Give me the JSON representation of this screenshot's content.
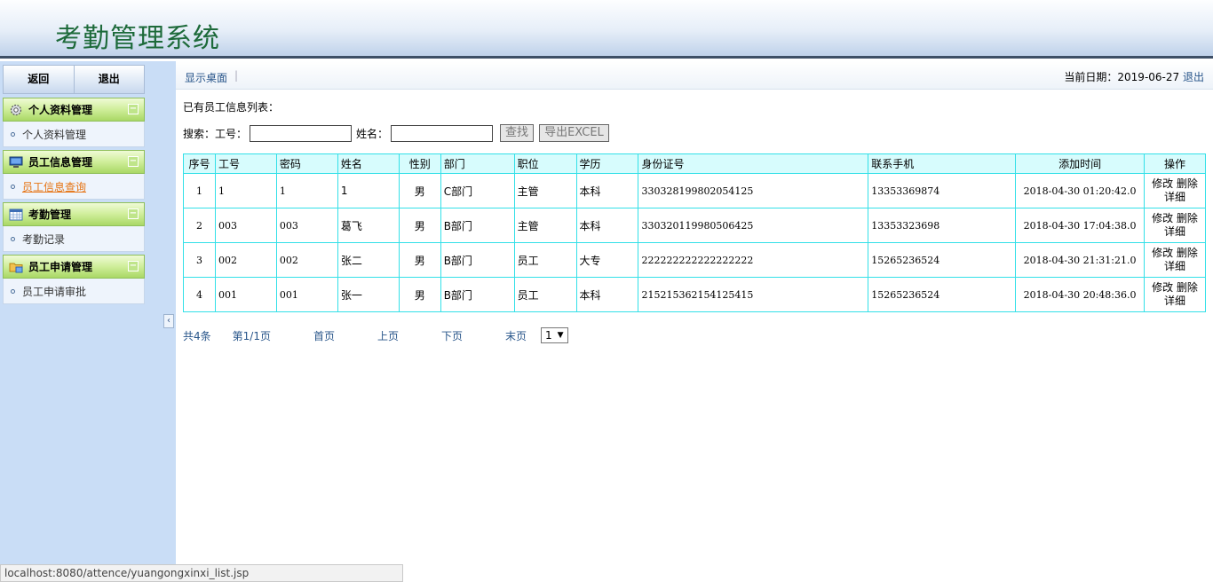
{
  "app": {
    "title": "考勤管理系统"
  },
  "sidebar": {
    "buttons": {
      "back": "返回",
      "exit": "退出"
    },
    "panels": [
      {
        "title": "个人资料管理",
        "icon": "gear-icon",
        "items": [
          "个人资料管理"
        ]
      },
      {
        "title": "员工信息管理",
        "icon": "monitor-icon",
        "items": [
          "员工信息查询"
        ]
      },
      {
        "title": "考勤管理",
        "icon": "calendar-icon",
        "items": [
          "考勤记录"
        ]
      },
      {
        "title": "员工申请管理",
        "icon": "folder-icon",
        "items": [
          "员工申请审批"
        ]
      }
    ],
    "active_item": "员工信息查询",
    "collapse_glyph": "‹"
  },
  "topbar": {
    "show_desktop": "显示桌面",
    "separator": "|",
    "date_label": "当前日期：",
    "date_value": "2019-06-27",
    "logout": "退出"
  },
  "main": {
    "list_title": "已有员工信息列表：",
    "search": {
      "prefix": "搜索：",
      "id_label": "工号：",
      "id_value": "",
      "name_label": "姓名：",
      "name_value": "",
      "find_button": "查找",
      "export_button": "导出EXCEL"
    }
  },
  "table": {
    "headers": [
      "序号",
      "工号",
      "密码",
      "姓名",
      "性别",
      "部门",
      "职位",
      "学历",
      "身份证号",
      "联系手机",
      "添加时间",
      "操作"
    ],
    "rows": [
      {
        "seq": "1",
        "id": "1",
        "pwd": "1",
        "name": "1",
        "gender": "男",
        "dept": "C部门",
        "position": "主管",
        "edu": "本科",
        "idcard": "330328199802054125",
        "phone": "13353369874",
        "added": "2018-04-30 01:20:42.0",
        "op_edit": "修改",
        "op_delete": "删除",
        "op_detail": "详细"
      },
      {
        "seq": "2",
        "id": "003",
        "pwd": "003",
        "name": "葛飞",
        "gender": "男",
        "dept": "B部门",
        "position": "主管",
        "edu": "本科",
        "idcard": "330320119980506425",
        "phone": "13353323698",
        "added": "2018-04-30 17:04:38.0",
        "op_edit": "修改",
        "op_delete": "删除",
        "op_detail": "详细"
      },
      {
        "seq": "3",
        "id": "002",
        "pwd": "002",
        "name": "张二",
        "gender": "男",
        "dept": "B部门",
        "position": "员工",
        "edu": "大专",
        "idcard": "222222222222222222",
        "phone": "15265236524",
        "added": "2018-04-30 21:31:21.0",
        "op_edit": "修改",
        "op_delete": "删除",
        "op_detail": "详细"
      },
      {
        "seq": "4",
        "id": "001",
        "pwd": "001",
        "name": "张一",
        "gender": "男",
        "dept": "B部门",
        "position": "员工",
        "edu": "本科",
        "idcard": "215215362154125415",
        "phone": "15265236524",
        "added": "2018-04-30 20:48:36.0",
        "op_edit": "修改",
        "op_delete": "删除",
        "op_detail": "详细"
      }
    ]
  },
  "pager": {
    "total": "共4条",
    "page_info": "第1/1页",
    "first": "首页",
    "prev": "上页",
    "next": "下页",
    "last": "末页",
    "selected_page": "1"
  },
  "statusbar": {
    "url": "localhost:8080/attence/yuangongxinxi_list.jsp"
  }
}
